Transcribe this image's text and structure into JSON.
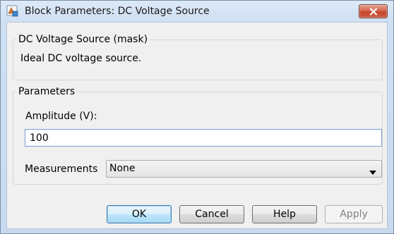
{
  "window": {
    "title": "Block Parameters: DC Voltage Source",
    "title_icon": "simulink-block-icon",
    "close_icon": "close-icon"
  },
  "description": {
    "group_title": "DC Voltage Source (mask)",
    "text": "Ideal DC voltage source."
  },
  "parameters": {
    "group_title": "Parameters",
    "amplitude_label": "Amplitude (V):",
    "amplitude_value": "100",
    "measurements_label": "Measurements",
    "measurements_selected": "None",
    "measurements_arrow_icon": "dropdown-arrow-icon"
  },
  "buttons": {
    "ok": "OK",
    "cancel": "Cancel",
    "help": "Help",
    "apply": "Apply"
  },
  "colors": {
    "close_button": "#c4452c",
    "default_button_border": "#3c7fb1",
    "input_border": "#7a9cd3"
  }
}
